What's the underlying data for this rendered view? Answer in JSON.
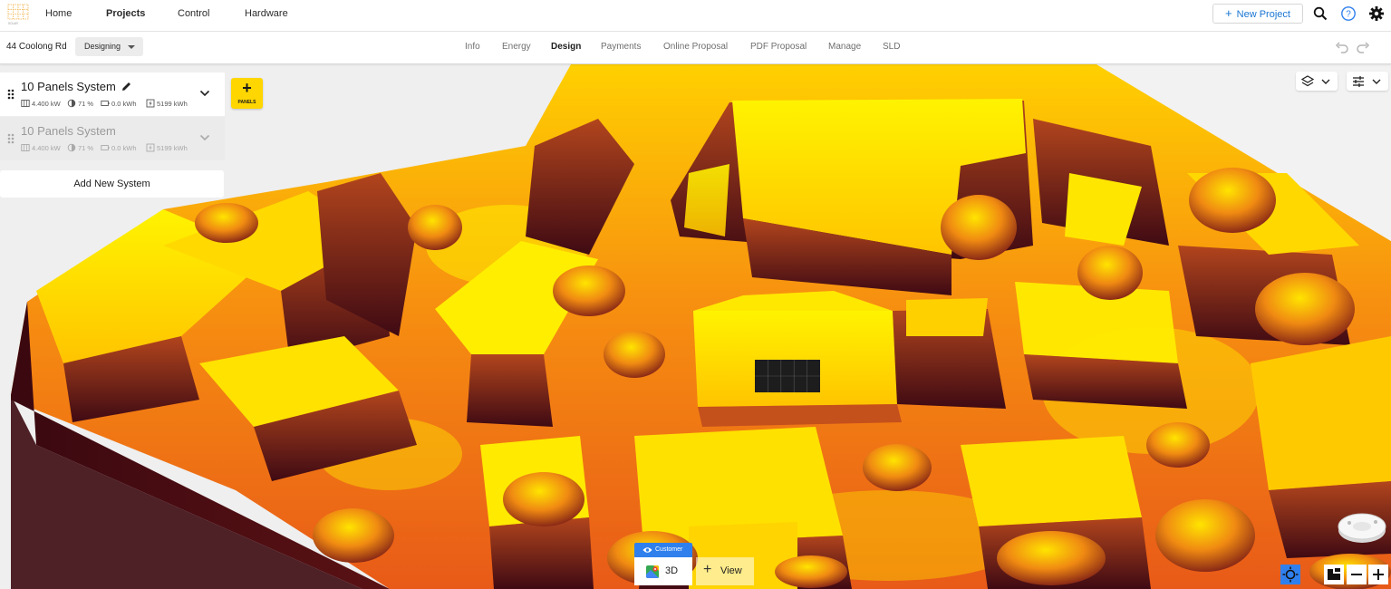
{
  "nav": {
    "links": [
      "Home",
      "Projects",
      "Control",
      "Hardware"
    ],
    "active": "Projects",
    "new_project_label": "New Project",
    "logo_text": "SOLAR"
  },
  "project": {
    "address": "44 Coolong Rd",
    "status": "Designing"
  },
  "tabs": [
    "Info",
    "Energy",
    "Design",
    "Payments",
    "Online Proposal",
    "PDF Proposal",
    "Manage",
    "SLD"
  ],
  "active_tab": "Design",
  "systems": [
    {
      "title": "10 Panels System",
      "kw": "4.400 kW",
      "pct": "71 %",
      "battery": "0.0 kWh",
      "output": "5199 kWh",
      "selected": true
    },
    {
      "title": "10 Panels System",
      "kw": "4.400 kW",
      "pct": "71 %",
      "battery": "0.0 kWh",
      "output": "5199 kWh",
      "selected": false
    }
  ],
  "add_system_label": "Add New System",
  "panels_button": {
    "plus": "+",
    "label": "PANELS"
  },
  "bottom": {
    "customer_label": "Customer",
    "mode_label": "3D",
    "view_plus": "+",
    "view_label": "View"
  },
  "colors": {
    "accent": "#1976d2",
    "panels_yellow": "#ffd600",
    "customer_blue": "#2f80ed",
    "heat_dark": "#4a0b12",
    "heat_mid": "#e8541a",
    "heat_hot": "#ffef00"
  },
  "icons": [
    "grid-logo-icon",
    "search-icon",
    "help-icon",
    "gear-icon",
    "undo-icon",
    "redo-icon",
    "layers-icon",
    "tune-icon",
    "drag-handle-icon",
    "pencil-icon",
    "panel-icon",
    "sun-icon",
    "battery-icon",
    "output-icon",
    "chevron-down-icon",
    "eye-icon",
    "map-pin-icon",
    "compass-icon",
    "zoom-in-icon",
    "zoom-out-icon"
  ]
}
